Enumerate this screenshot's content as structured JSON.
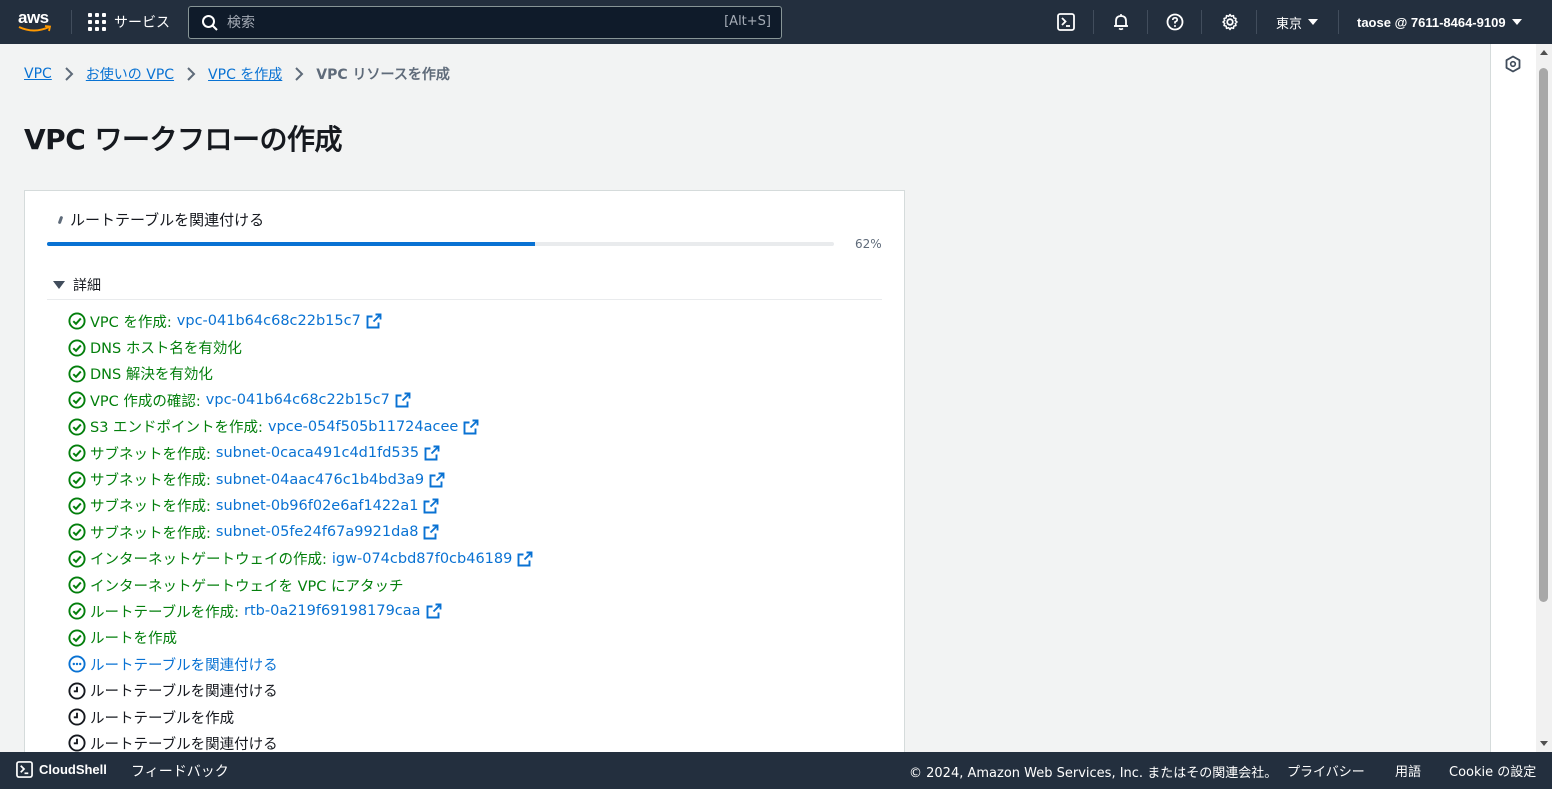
{
  "topnav": {
    "logo_text": "aws",
    "services_label": "サービス",
    "search_placeholder": "検索",
    "search_shortcut": "[Alt+S]",
    "region": "東京",
    "account": "taose @ 7611-8464-9109"
  },
  "breadcrumb": [
    {
      "label": "VPC"
    },
    {
      "label": "お使いの VPC"
    },
    {
      "label": "VPC を作成"
    },
    {
      "label": "VPC リソースを作成"
    }
  ],
  "page_title": "VPC ワークフローの作成",
  "progress": {
    "current_step": "ルートテーブルを関連付ける",
    "percent_label": "62%",
    "percent": 62
  },
  "details_label": "詳細",
  "steps": [
    {
      "status": "done",
      "text": "VPC を作成:",
      "resource": "vpc-041b64c68c22b15c7"
    },
    {
      "status": "done",
      "text": "DNS ホスト名を有効化",
      "resource": null
    },
    {
      "status": "done",
      "text": "DNS 解決を有効化",
      "resource": null
    },
    {
      "status": "done",
      "text": "VPC 作成の確認:",
      "resource": "vpc-041b64c68c22b15c7"
    },
    {
      "status": "done",
      "text": "S3 エンドポイントを作成:",
      "resource": "vpce-054f505b11724acee"
    },
    {
      "status": "done",
      "text": "サブネットを作成:",
      "resource": "subnet-0caca491c4d1fd535"
    },
    {
      "status": "done",
      "text": "サブネットを作成:",
      "resource": "subnet-04aac476c1b4bd3a9"
    },
    {
      "status": "done",
      "text": "サブネットを作成:",
      "resource": "subnet-0b96f02e6af1422a1"
    },
    {
      "status": "done",
      "text": "サブネットを作成:",
      "resource": "subnet-05fe24f67a9921da8"
    },
    {
      "status": "done",
      "text": "インターネットゲートウェイの作成:",
      "resource": "igw-074cbd87f0cb46189"
    },
    {
      "status": "done",
      "text": "インターネットゲートウェイを VPC にアタッチ",
      "resource": null
    },
    {
      "status": "done",
      "text": "ルートテーブルを作成:",
      "resource": "rtb-0a219f69198179caa"
    },
    {
      "status": "done",
      "text": "ルートを作成",
      "resource": null
    },
    {
      "status": "running",
      "text": "ルートテーブルを関連付ける",
      "resource": null
    },
    {
      "status": "pending",
      "text": "ルートテーブルを関連付ける",
      "resource": null
    },
    {
      "status": "pending",
      "text": "ルートテーブルを作成",
      "resource": null
    },
    {
      "status": "pending",
      "text": "ルートテーブルを関連付ける",
      "resource": null
    }
  ],
  "footer": {
    "cloudshell": "CloudShell",
    "feedback": "フィードバック",
    "copyright": "© 2024, Amazon Web Services, Inc. またはその関連会社。",
    "privacy": "プライバシー",
    "terms": "用語",
    "cookie": "Cookie の設定"
  },
  "colors": {
    "nav_bg": "#232f3e",
    "link": "#0972d3",
    "success": "#037f0c",
    "progress": "#0972d3"
  }
}
